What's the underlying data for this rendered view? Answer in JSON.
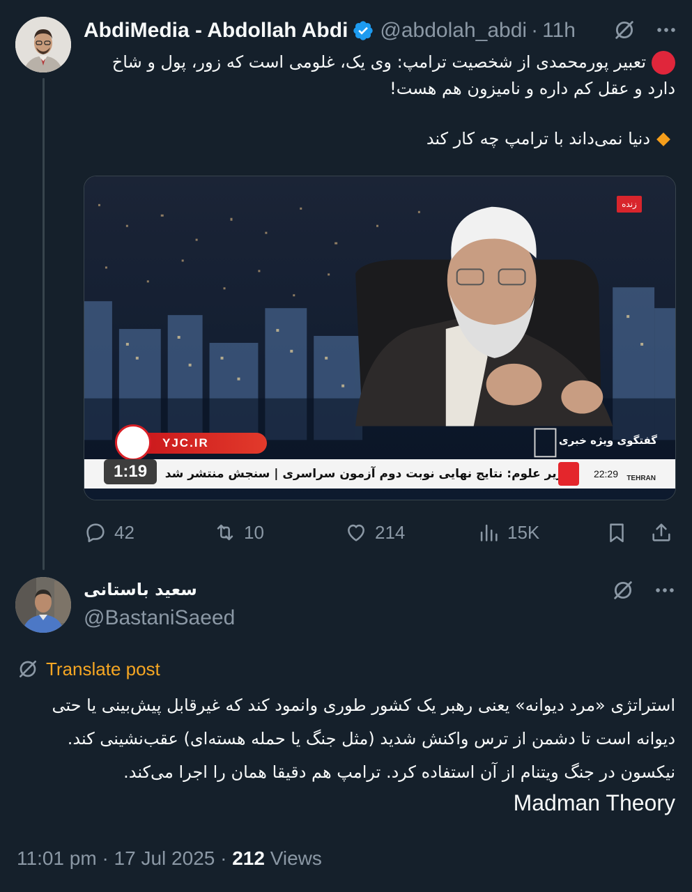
{
  "tweet": {
    "author_name": "AbdiMedia - Abdollah Abdi",
    "handle": "@abdolah_abdi",
    "separator": "·",
    "time": "11h",
    "text_line1": "تعبیر پورمحمدی از شخصیت ترامپ: وی یک، غلومی است که زور، پول و شاخ دارد و عقل کم داره و نامیزون هم هست!",
    "text_line2": "دنیا نمی‌داند با ترامپ چه کار کند",
    "video": {
      "duration": "1:19",
      "live_label": "زنده",
      "watermark": "YJC.IR",
      "segment_title": "گفتگوی ویژه خبری",
      "ticker_text": "وزیر علوم: نتایج نهایی نوبت دوم آزمون سراسری | سنجش منتشر شد",
      "ticker_time": "22:29",
      "ticker_city": "TEHRAN"
    },
    "stats": {
      "replies": "42",
      "retweets": "10",
      "likes": "214",
      "views": "15K"
    }
  },
  "reply": {
    "author_name": "سعید باستانی",
    "handle": "@BastaniSaeed",
    "translate_label": "Translate post",
    "text": "استراتژی «مرد دیوانه» یعنی رهبر یک کشور طوری وانمود کند که غیرقابل پیش‌بینی یا حتی دیوانه است تا دشمن از ترس واکنش شدید (مثل جنگ یا حمله هسته‌ای) عقب‌نشینی کند. نیکسون در جنگ ویتنام از آن استفاده کرد. ترامپ هم دقیقا همان را اجرا می‌کند.",
    "text_en": "Madman Theory",
    "timestamp": "11:01 pm · 17 Jul 2025 ·",
    "views_count": "212",
    "views_label": "Views"
  },
  "colors": {
    "background": "#15202b",
    "text": "#f7f9f9",
    "secondary": "#8b98a5",
    "verified": "#1d9bf0",
    "translate": "#f5a623"
  },
  "icons": [
    "verified-badge-icon",
    "grok-icon",
    "more-icon",
    "reply-icon",
    "retweet-icon",
    "like-icon",
    "views-icon",
    "bookmark-icon",
    "share-icon",
    "translate-icon"
  ]
}
